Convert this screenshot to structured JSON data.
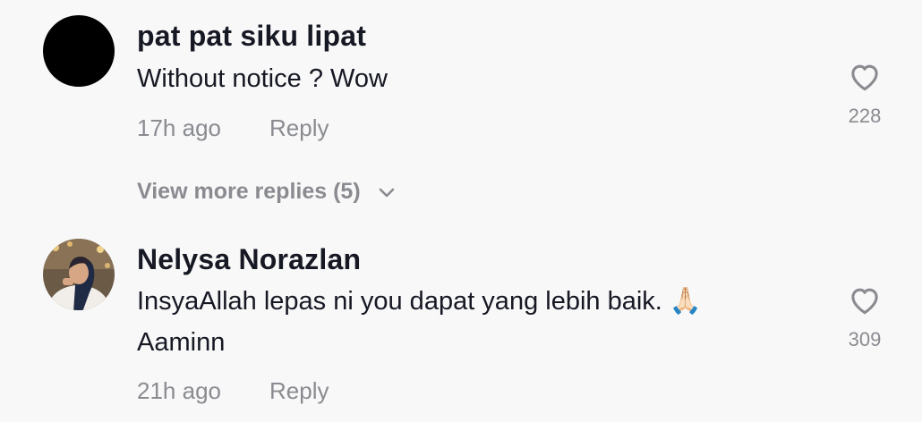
{
  "comments": [
    {
      "username": "pat pat siku lipat",
      "text_lines": [
        "Without notice ? Wow"
      ],
      "time": "17h ago",
      "reply_label": "Reply",
      "likes": "228",
      "avatar_icon": "black-circle-avatar"
    },
    {
      "username": "Nelysa Norazlan",
      "text_lines": [
        "InsyaAllah lepas ni you dapat yang lebih baik. 🙏🏻",
        "Aaminn"
      ],
      "time": "21h ago",
      "reply_label": "Reply",
      "likes": "309",
      "avatar_icon": "photo-avatar"
    }
  ],
  "view_more": {
    "label": "View more replies (5)",
    "icon": "chevron-down-icon"
  },
  "icons": {
    "like": "heart-outline-icon"
  },
  "colors": {
    "background": "#f8f8f8",
    "primary_text": "#161823",
    "secondary_text": "#8a8b91"
  }
}
